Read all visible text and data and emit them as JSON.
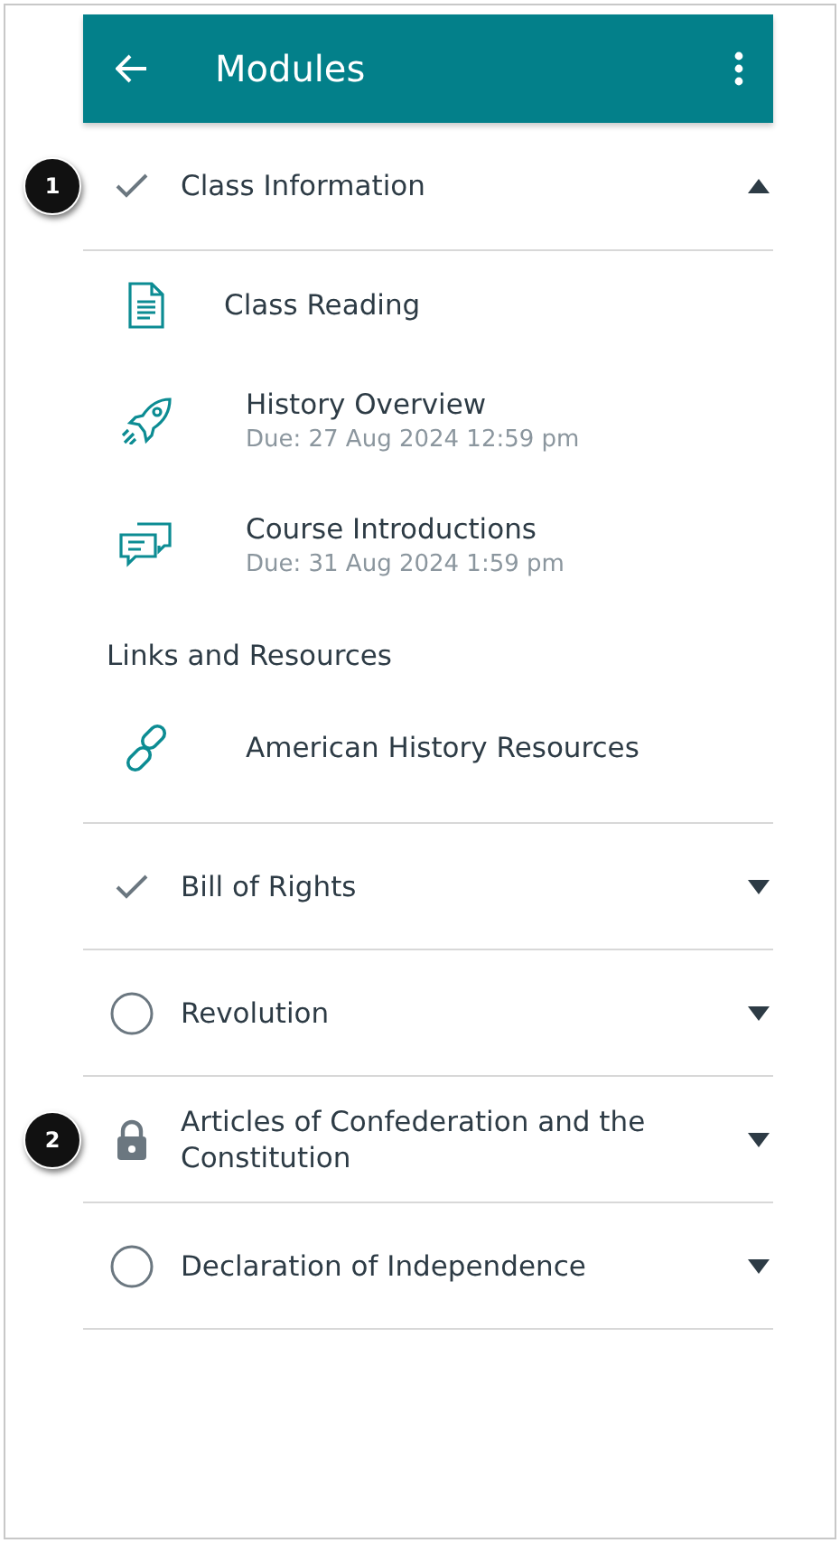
{
  "header": {
    "title": "Modules"
  },
  "modules": [
    {
      "title": "Class Information",
      "kind": "complete",
      "expanded": true,
      "callout": "1",
      "items": [
        {
          "kind": "page",
          "title": "Class Reading"
        },
        {
          "kind": "assignment",
          "title": "History Overview",
          "due": "Due: 27 Aug 2024 12:59 pm"
        },
        {
          "kind": "discussion",
          "title": "Course Introductions",
          "due": "Due: 31 Aug 2024 1:59 pm"
        },
        {
          "kind": "subheader",
          "title": "Links and Resources"
        },
        {
          "kind": "link",
          "title": "American History Resources"
        }
      ]
    },
    {
      "title": "Bill of Rights",
      "kind": "complete",
      "expanded": false
    },
    {
      "title": "Revolution",
      "kind": "incomplete",
      "expanded": false
    },
    {
      "title": "Articles of Confederation and the Constitution",
      "kind": "locked",
      "expanded": false,
      "callout": "2"
    },
    {
      "title": "Declaration of Independence",
      "kind": "incomplete",
      "expanded": false
    }
  ]
}
